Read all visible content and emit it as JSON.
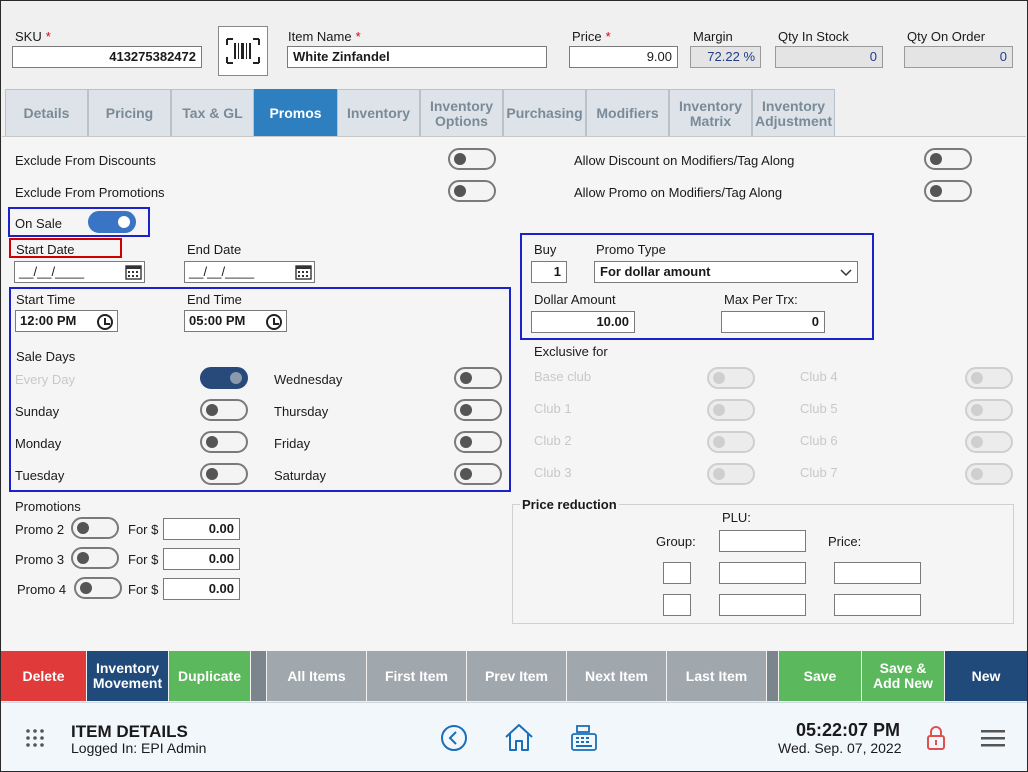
{
  "header": {
    "sku_label": "SKU",
    "sku_value": "413275382472",
    "item_name_label": "Item Name",
    "item_name_value": "White Zinfandel",
    "price_label": "Price",
    "price_value": "9.00",
    "required_mark": "*",
    "margin_label": "Margin",
    "margin_value": "72.22 %",
    "qty_in_stock_label": "Qty In Stock",
    "qty_in_stock_value": "0",
    "qty_on_order_label": "Qty On Order",
    "qty_on_order_value": "0"
  },
  "tabs": [
    {
      "label": "Details"
    },
    {
      "label": "Pricing"
    },
    {
      "label": "Tax & GL"
    },
    {
      "label": "Promos"
    },
    {
      "label": "Inventory"
    },
    {
      "label": "Inventory Options"
    },
    {
      "label": "Purchasing"
    },
    {
      "label": "Modifiers"
    },
    {
      "label": "Inventory Matrix"
    },
    {
      "label": "Inventory Adjustment"
    }
  ],
  "promos": {
    "exclude_discounts": "Exclude From Discounts",
    "exclude_promotions": "Exclude From Promotions",
    "allow_discount_modifiers": "Allow Discount on Modifiers/Tag Along",
    "allow_promo_modifiers": "Allow Promo on Modifiers/Tag Along",
    "on_sale": "On Sale",
    "start_date_label": "Start Date",
    "start_date_value": "__/__/____",
    "end_date_label": "End Date",
    "end_date_value": "__/__/____",
    "start_time_label": "Start Time",
    "start_time_value": "12:00 PM",
    "end_time_label": "End Time",
    "end_time_value": "05:00 PM",
    "sale_days_label": "Sale Days",
    "days": {
      "every_day": "Every Day",
      "sunday": "Sunday",
      "monday": "Monday",
      "tuesday": "Tuesday",
      "wednesday": "Wednesday",
      "thursday": "Thursday",
      "friday": "Friday",
      "saturday": "Saturday"
    },
    "buy_label": "Buy",
    "buy_value": "1",
    "promo_type_label": "Promo Type",
    "promo_type_value": "For dollar amount",
    "dollar_amount_label": "Dollar Amount",
    "dollar_amount_value": "10.00",
    "max_per_trx_label": "Max Per Trx:",
    "max_per_trx_value": "0",
    "exclusive_for_label": "Exclusive for",
    "clubs": [
      "Base club",
      "Club 1",
      "Club 2",
      "Club 3",
      "Club 4",
      "Club 5",
      "Club 6",
      "Club 7"
    ],
    "promotions_label": "Promotions",
    "promotion_rows": [
      {
        "label": "Promo 2",
        "for": "For $",
        "value": "0.00"
      },
      {
        "label": "Promo 3",
        "for": "For $",
        "value": "0.00"
      },
      {
        "label": "Promo 4",
        "for": "For $",
        "value": "0.00"
      }
    ],
    "price_reduction_label": "Price reduction",
    "plu_label": "PLU:",
    "group_label": "Group:",
    "price_label": "Price:"
  },
  "actions": {
    "delete": "Delete",
    "inventory_movement": "Inventory Movement",
    "duplicate": "Duplicate",
    "all_items": "All Items",
    "first_item": "First Item",
    "prev_item": "Prev Item",
    "next_item": "Next Item",
    "last_item": "Last Item",
    "save": "Save",
    "save_add_new": "Save & Add New",
    "new": "New"
  },
  "footer": {
    "title": "ITEM DETAILS",
    "logged_in": "Logged In:  EPI Admin",
    "time": "05:22:07 PM",
    "date": "Wed. Sep. 07, 2022"
  },
  "colors": {
    "active_tab": "#2e7fc0",
    "delete": "#e03a3a",
    "inventory_movement": "#1f4a7a",
    "duplicate": "#5cb85c",
    "nav_gray": "#a0a8ae",
    "save": "#5cb85c",
    "new": "#1f4a7a",
    "highlight_box": "#1b22c8",
    "start_date_box": "#d10000"
  }
}
